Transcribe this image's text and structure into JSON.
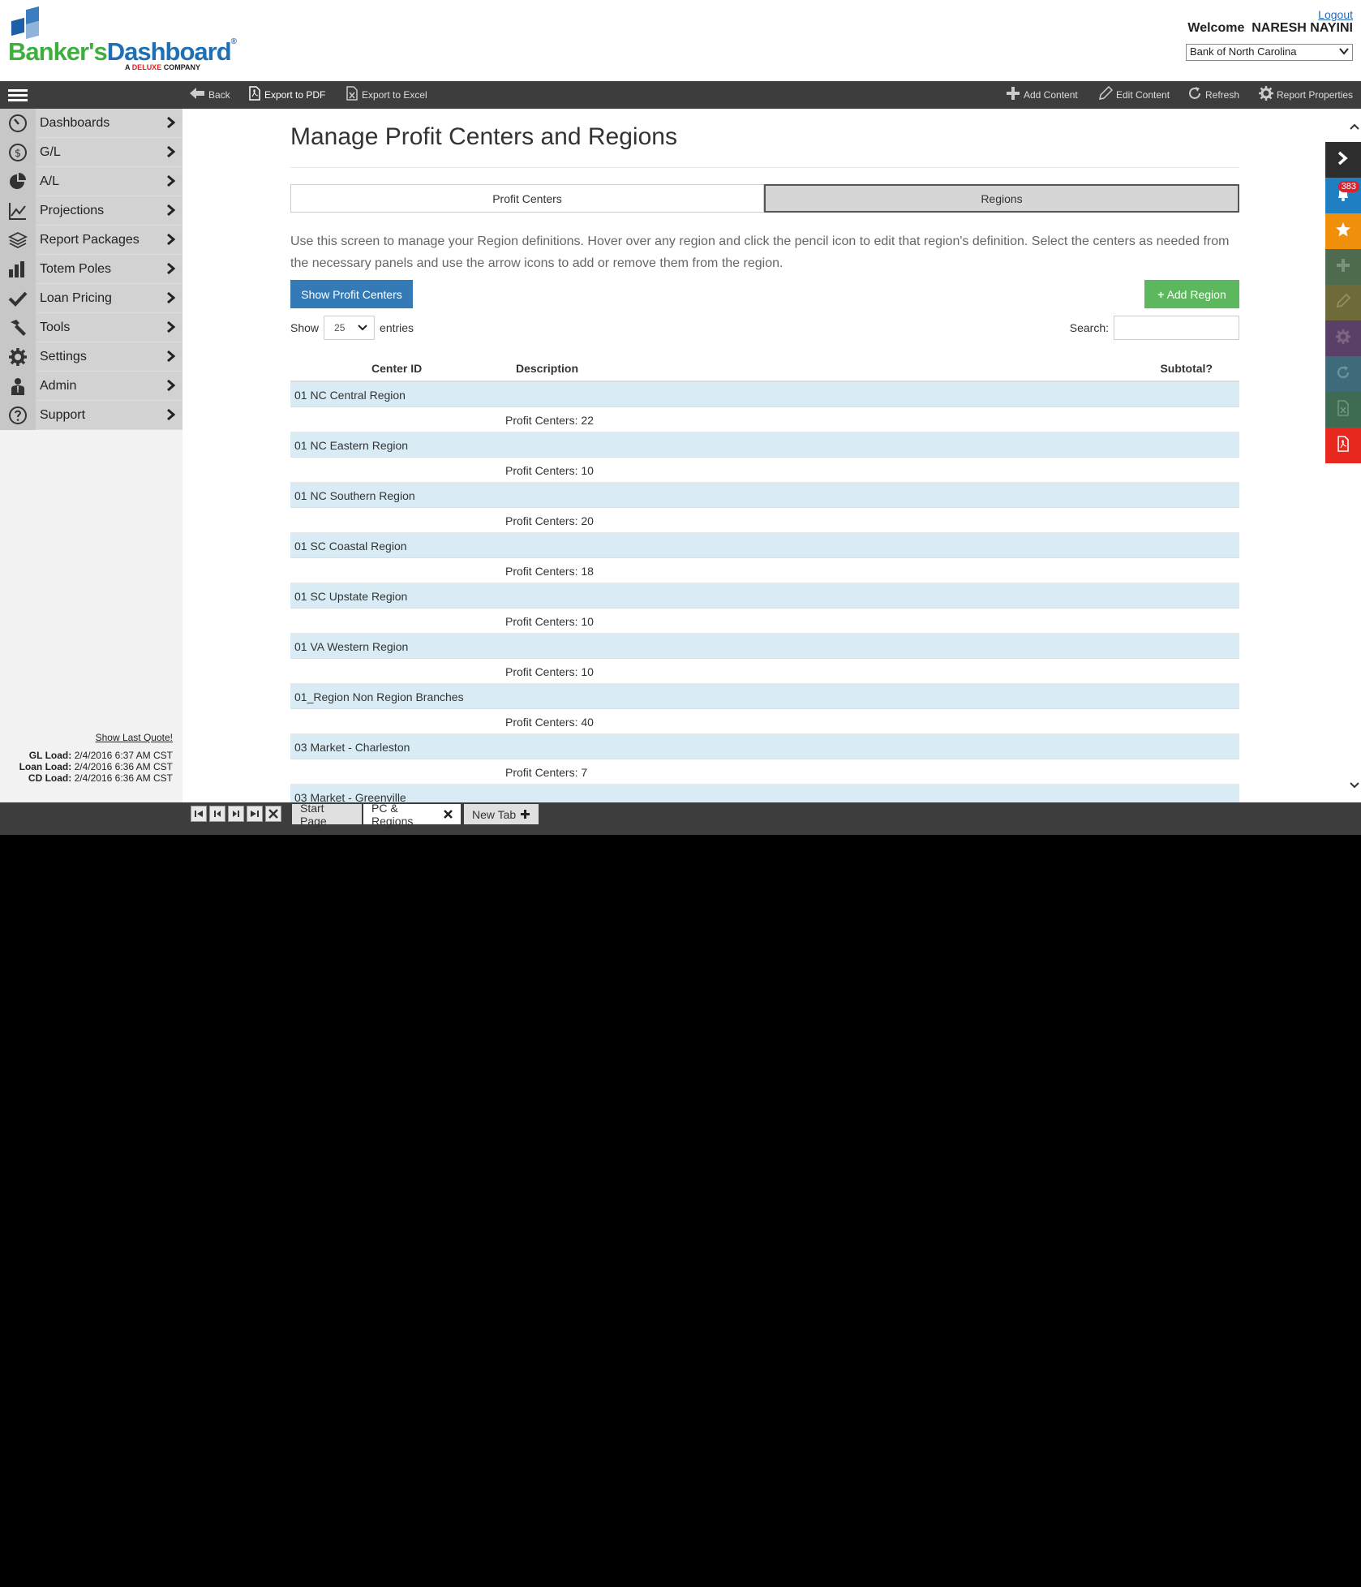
{
  "header": {
    "brand_part1": "Banker's",
    "brand_part2": "Dashboard",
    "brand_tm": "®",
    "tagline_prefix": "A",
    "tagline_brand": "DELUXE",
    "tagline_suffix": "COMPANY",
    "logout": "Logout",
    "welcome_label": "Welcome",
    "user_name": "NARESH NAYINI",
    "bank_select_value": "Bank of North Carolina"
  },
  "toolbar": {
    "back": "Back",
    "export_pdf": "Export to PDF",
    "export_excel": "Export to Excel",
    "add_content": "Add Content",
    "edit_content": "Edit Content",
    "refresh": "Refresh",
    "report_properties": "Report Properties"
  },
  "sidebar": {
    "items": [
      {
        "label": "Dashboards",
        "icon": "speedometer-icon"
      },
      {
        "label": "G/L",
        "icon": "dollar-icon"
      },
      {
        "label": "A/L",
        "icon": "pie-chart-icon"
      },
      {
        "label": "Projections",
        "icon": "line-chart-icon"
      },
      {
        "label": "Report Packages",
        "icon": "layers-icon"
      },
      {
        "label": "Totem Poles",
        "icon": "bar-chart-icon"
      },
      {
        "label": "Loan Pricing",
        "icon": "checkmark-icon"
      },
      {
        "label": "Tools",
        "icon": "hammer-icon"
      },
      {
        "label": "Settings",
        "icon": "gear-icon"
      },
      {
        "label": "Admin",
        "icon": "admin-user-icon"
      },
      {
        "label": "Support",
        "icon": "question-icon"
      }
    ],
    "show_last_quote": "Show Last Quote!",
    "loads": [
      {
        "label": "GL Load:",
        "value": "2/4/2016 6:37 AM CST"
      },
      {
        "label": "Loan Load:",
        "value": "2/4/2016 6:36 AM CST"
      },
      {
        "label": "CD Load:",
        "value": "2/4/2016 6:36 AM CST"
      }
    ]
  },
  "main": {
    "title": "Manage Profit Centers and Regions",
    "tabs": [
      {
        "label": "Profit Centers",
        "active": false
      },
      {
        "label": "Regions",
        "active": true
      }
    ],
    "description": "Use this screen to manage your Region definitions. Hover over any region and click the pencil icon to edit that region's definition. Select the centers as needed from the necessary panels and use the arrow icons to add or remove them from the region.",
    "show_profit_centers_button": "Show Profit Centers",
    "add_region_button": "Add Region",
    "show_label": "Show",
    "entries_value": "25",
    "entries_label": "entries",
    "search_label": "Search:",
    "columns": {
      "center_id": "Center ID",
      "description": "Description",
      "subtotal": "Subtotal?"
    },
    "regions": [
      {
        "name": "01 NC Central Region",
        "count": "Profit Centers: 22"
      },
      {
        "name": "01 NC Eastern Region",
        "count": "Profit Centers: 10"
      },
      {
        "name": "01 NC Southern Region",
        "count": "Profit Centers: 20"
      },
      {
        "name": "01 SC Coastal Region",
        "count": "Profit Centers: 18"
      },
      {
        "name": "01 SC Upstate Region",
        "count": "Profit Centers: 10"
      },
      {
        "name": "01 VA Western Region",
        "count": "Profit Centers: 10"
      },
      {
        "name": "01_Region Non Region Branches",
        "count": "Profit Centers: 40"
      },
      {
        "name": "03 Market - Charleston",
        "count": "Profit Centers: 7"
      },
      {
        "name": "03 Market - Greenville",
        "count": ""
      }
    ]
  },
  "rail": {
    "notification_count": "383",
    "colors": [
      "#2d2d2d",
      "#1f7fc0",
      "#f0900a",
      "#4f6b4f",
      "#6f6a3a",
      "#5a3f66",
      "#3e6b7a",
      "#3f6b52",
      "#e8281e"
    ],
    "icons": [
      "expand-arrow-icon",
      "bell-icon",
      "star-icon",
      "plus-icon",
      "pencil-icon",
      "gear-icon",
      "refresh-icon",
      "excel-icon",
      "pdf-icon"
    ]
  },
  "bottombar": {
    "tabs": [
      {
        "label": "Start Page"
      },
      {
        "label": "PC & Regions"
      },
      {
        "label": "New Tab"
      }
    ]
  }
}
